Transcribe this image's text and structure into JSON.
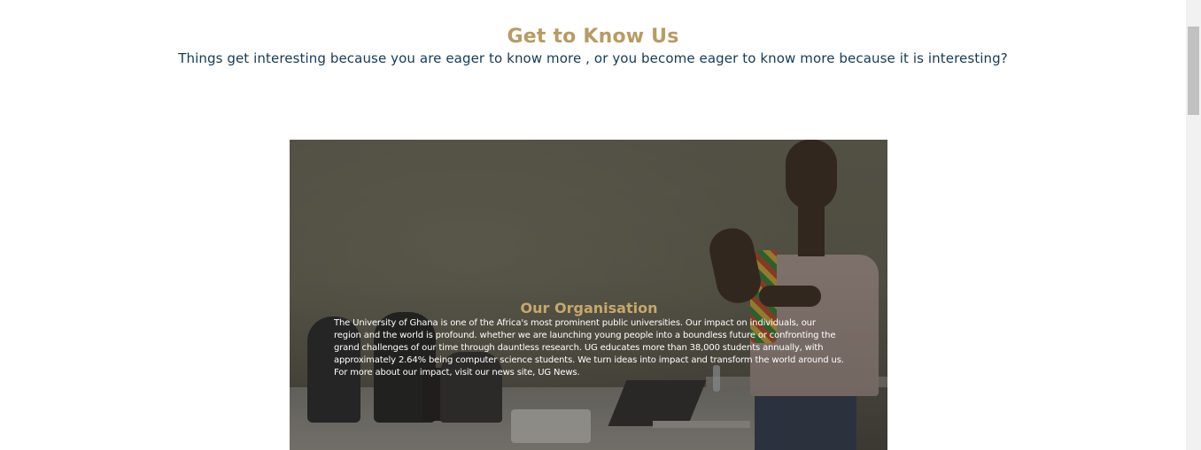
{
  "section": {
    "title": "Get to Know Us",
    "subtitle": "Things get interesting because you are eager to know more , or you become eager to know more because it is interesting?"
  },
  "organisation": {
    "title": "Our Organisation",
    "description": "The University of Ghana is one of the Africa's most prominent public universities. Our impact on individuals, our region and the world is profound. whether we are launching young people into a boundless future or confronting the grand challenges of our time through dauntless research. UG educates more than 38,000 students annually, with approximately 2.64% being computer science students. We turn ideas into impact and transform the world around us. For more about our impact, visit our news site, UG News."
  },
  "colors": {
    "title_gold": "#b89b63",
    "subtitle_navy": "#153a57",
    "org_title_gold": "#c7a86a"
  }
}
